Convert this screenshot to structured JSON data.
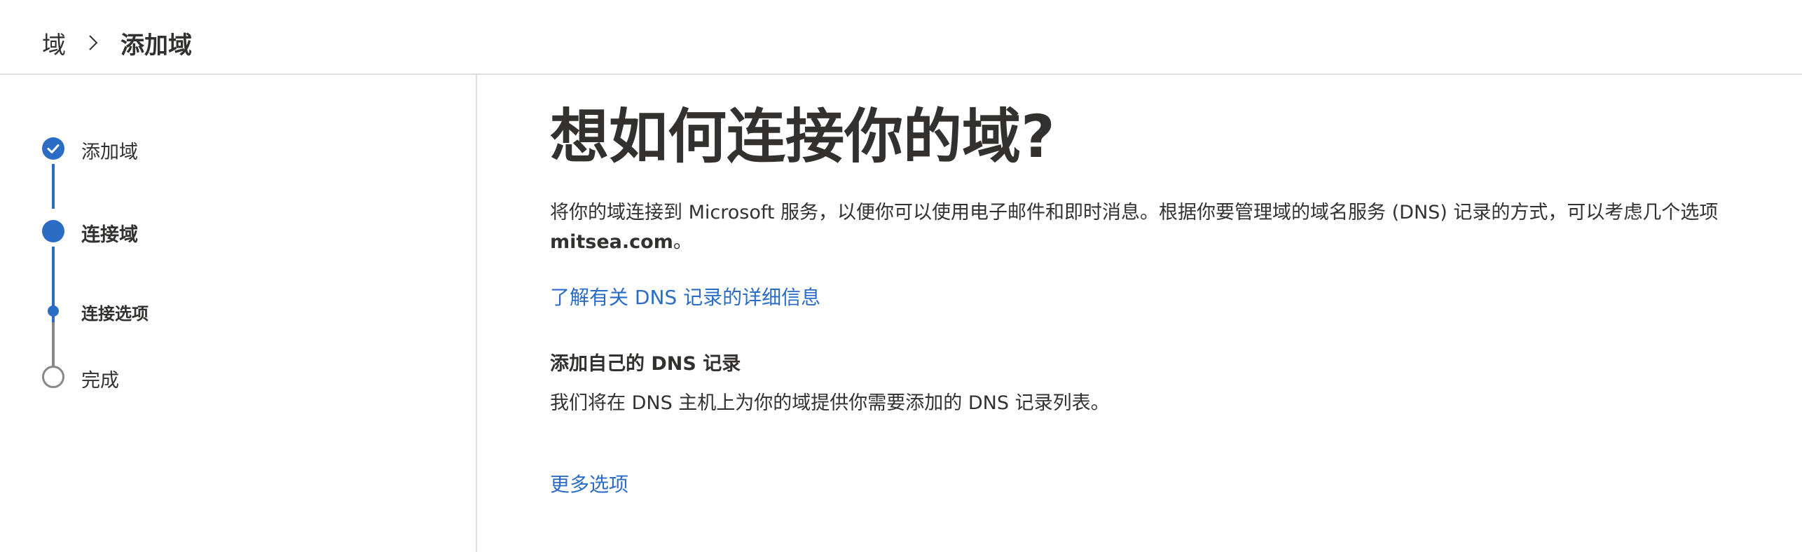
{
  "breadcrumb": {
    "root": "域",
    "current": "添加域"
  },
  "stepper": {
    "steps": [
      {
        "label": "添加域",
        "state": "completed"
      },
      {
        "label": "连接域",
        "state": "current"
      },
      {
        "label": "连接选项",
        "state": "current-substep"
      },
      {
        "label": "完成",
        "state": "pending"
      }
    ]
  },
  "main": {
    "title": "想如何连接你的域?",
    "description_prefix": "将你的域连接到 Microsoft 服务，以便你可以使用电子邮件和即时消息。根据你要管理域的域名服务 (DNS) 记录的方式，可以考虑几个选项",
    "domain": "mitsea.com",
    "description_suffix": "。",
    "learn_more_link": "了解有关 DNS 记录的详细信息",
    "option_title": "添加自己的 DNS 记录",
    "option_description": "我们将在 DNS 主机上为你的域提供你需要添加的 DNS 记录列表。",
    "more_options_link": "更多选项"
  },
  "colors": {
    "accent": "#2b6cc4",
    "text": "#323130",
    "pending": "#8a8886",
    "divider": "#e1dfdd"
  }
}
